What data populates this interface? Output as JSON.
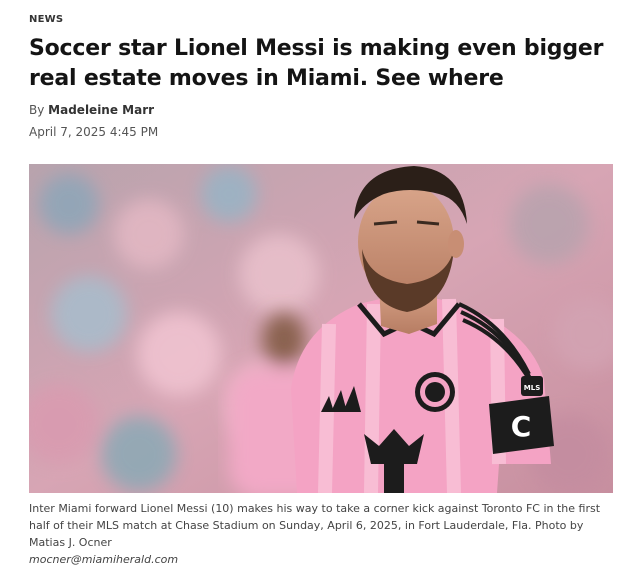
{
  "article": {
    "section": "NEWS",
    "headline": "Soccer star Lionel Messi is making even bigger real estate moves in Miami. See where",
    "byline_prefix": "By",
    "author": "Madeleine Marr",
    "date": "April 7, 2025 4:45 PM"
  },
  "photo": {
    "alt_subject": "Lionel Messi in a pink Inter Miami jersey with captain armband",
    "armband_letter": "C",
    "badge_text": "MLS"
  },
  "caption": {
    "text": "Inter Miami forward Lionel Messi (10) makes his way to take a corner kick against Toronto FC in the first half of their MLS match at Chase Stadium on Sunday, April 6, 2025, in Fort Lauderdale, Fla. Photo by Matias J. Ocner",
    "credit_email": "mocner@miamiherald.com"
  },
  "colors": {
    "jersey_pink": "#f4a3c4",
    "jersey_stripe": "#1c1c1c",
    "background_blur": "#c9a0ad"
  }
}
